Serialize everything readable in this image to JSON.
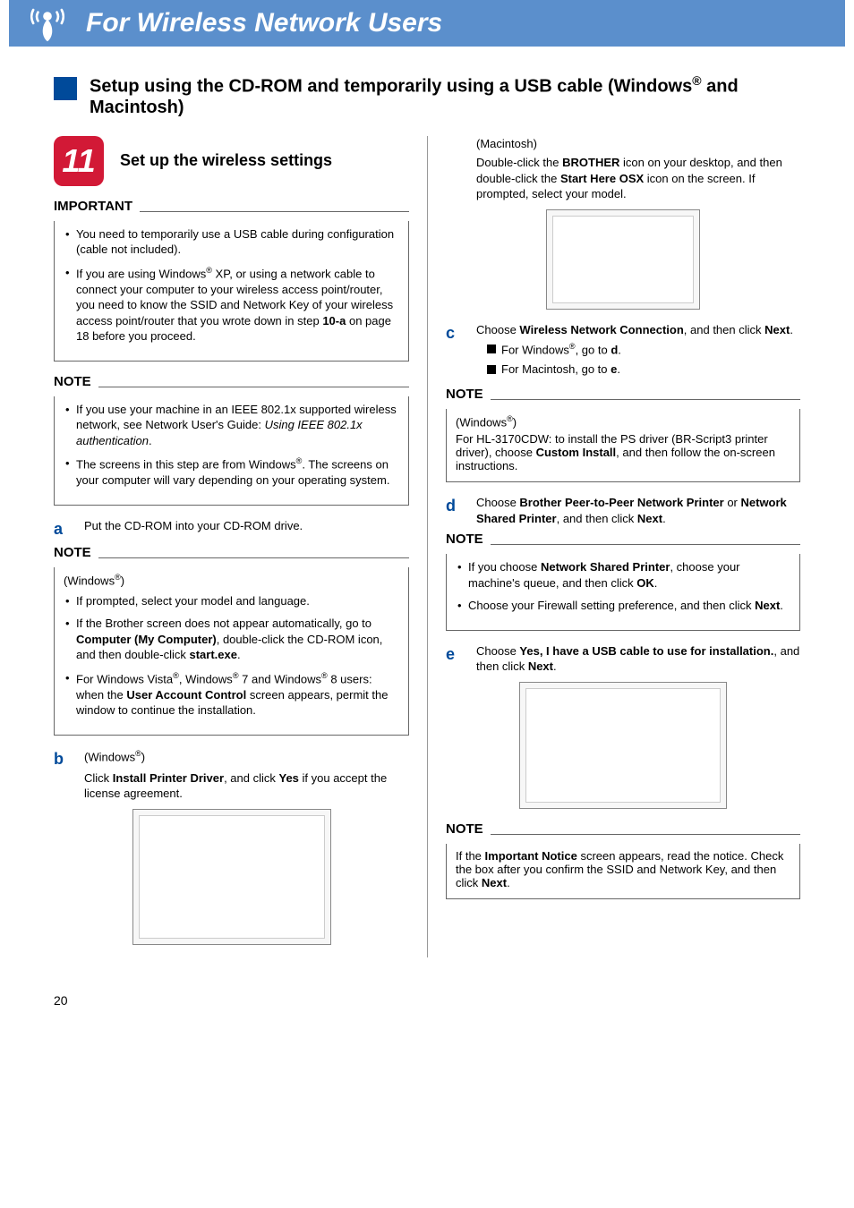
{
  "header": {
    "title": "For Wireless Network Users"
  },
  "section": {
    "title_html": "Setup using the CD-ROM and temporarily using a USB cable (Windows<sup>®</sup> and Macintosh)"
  },
  "step": {
    "number": "11",
    "title": "Set up the wireless settings"
  },
  "important": {
    "label": "IMPORTANT",
    "items": [
      "You need to temporarily use a USB cable during configuration (cable not included).",
      "If you are using Windows<sup>®</sup> XP, or using a network cable to connect your computer to your wireless access point/router, you need to know the SSID and Network Key of your wireless access point/router that you wrote down in step <b>10-a</b> on page 18 before you proceed."
    ]
  },
  "note1": {
    "label": "NOTE",
    "items": [
      "If you use your machine in an IEEE 802.1x supported wireless network, see Network User's Guide: <i>Using IEEE 802.1x authentication</i>.",
      "The screens in this step are from Windows<sup>®</sup>. The screens on your computer will vary depending on your operating system."
    ]
  },
  "sub_a": {
    "letter": "a",
    "text": "Put the CD-ROM into your CD-ROM drive."
  },
  "note2": {
    "label": "NOTE",
    "os": "(Windows<sup>®</sup>)",
    "items": [
      "If prompted, select your model and language.",
      "If the Brother screen does not appear automatically, go to <b>Computer (My Computer)</b>, double-click the CD-ROM icon, and then double-click <b>start.exe</b>.",
      "For Windows Vista<sup>®</sup>, Windows<sup>®</sup> 7 and Windows<sup>®</sup> 8 users: when the <b>User Account Control</b> screen appears, permit the window to continue the installation."
    ]
  },
  "sub_b": {
    "letter": "b",
    "os": "(Windows<sup>®</sup>)",
    "text": "Click <b>Install Printer Driver</b>, and click <b>Yes</b> if you accept the license agreement."
  },
  "mac_intro": {
    "os": "(Macintosh)",
    "text": "Double-click the <b>BROTHER</b> icon on your desktop, and then double-click the <b>Start Here OSX</b> icon on the screen. If prompted, select your model."
  },
  "sub_c": {
    "letter": "c",
    "text": "Choose <b>Wireless Network Connection</b>, and then click <b>Next</b>.",
    "subs": [
      "For Windows<sup>®</sup>, go to <b>d</b>.",
      "For Macintosh, go to <b>e</b>."
    ]
  },
  "note3": {
    "label": "NOTE",
    "os": "(Windows<sup>®</sup>)",
    "text": "For HL-3170CDW: to install the PS driver (BR-Script3 printer driver), choose <b>Custom Install</b>, and then follow the on-screen instructions."
  },
  "sub_d": {
    "letter": "d",
    "text": "Choose <b>Brother Peer-to-Peer Network Printer</b> or <b>Network Shared Printer</b>, and then click <b>Next</b>."
  },
  "note4": {
    "label": "NOTE",
    "items": [
      "If you choose <b>Network Shared Printer</b>, choose your machine's queue, and then click <b>OK</b>.",
      "Choose your Firewall setting preference, and then click <b>Next</b>."
    ]
  },
  "sub_e": {
    "letter": "e",
    "text": "Choose <b>Yes, I have a USB cable to use for installation.</b>, and then click <b>Next</b>."
  },
  "note5": {
    "label": "NOTE",
    "text": "If the <b>Important Notice</b> screen appears, read the notice. Check the box after you confirm the SSID and Network Key, and then click <b>Next</b>."
  },
  "page_number": "20"
}
